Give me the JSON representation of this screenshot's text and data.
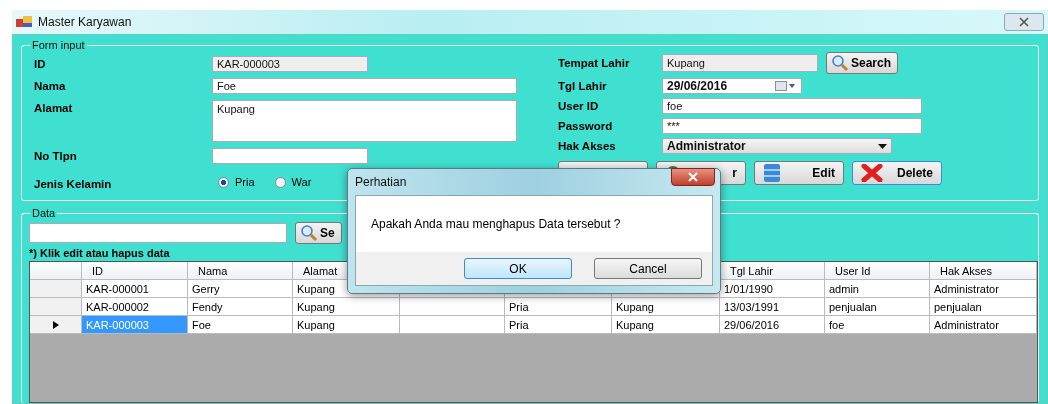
{
  "window": {
    "title": "Master Karyawan"
  },
  "form_input": {
    "title": "Form input",
    "left_fields": [
      {
        "label": "ID",
        "kind": "readonly",
        "value": "KAR-000003"
      },
      {
        "label": "Nama",
        "kind": "text",
        "value": "Foe"
      },
      {
        "label": "Alamat",
        "kind": "textarea",
        "value": "Kupang"
      },
      {
        "label": "No Tlpn",
        "kind": "short"
      },
      {
        "label": "Jenis Kelamin",
        "kind": "radio",
        "options": [
          {
            "label": "Pria",
            "selected": true
          },
          {
            "label": "War",
            "selected": false
          }
        ]
      }
    ],
    "right_fields": [
      {
        "label": "Tempat Lahir",
        "kind": "readonly",
        "value": "Kupang",
        "button": "Search"
      },
      {
        "label": "Tgl Lahir",
        "kind": "date",
        "value": "29/06/2016"
      },
      {
        "label": "User ID",
        "kind": "text",
        "value": "foe"
      },
      {
        "label": "Password",
        "kind": "text",
        "value": "***"
      },
      {
        "label": "Hak Akses",
        "kind": "combo",
        "value": "Administrator"
      }
    ],
    "buttons": [
      {
        "kind": "blank"
      },
      {
        "kind": "clear",
        "label": "r"
      },
      {
        "kind": "edit",
        "label": "Edit"
      },
      {
        "kind": "delete",
        "label": "Delete"
      }
    ]
  },
  "data": {
    "title": "Data",
    "search_button": "Se",
    "note": "*) Klik edit atau hapus data",
    "table": {
      "columns": [
        "ID",
        "Nama",
        "Alamat",
        null,
        null,
        null,
        "Tgl Lahir",
        "User Id",
        "Hak Akses"
      ],
      "rows": [
        {
          "selected": false,
          "cells": [
            "KAR-000001",
            "Gerry",
            "Kupang",
            null,
            null,
            null,
            "1/01/1990",
            "admin",
            "Administrator"
          ]
        },
        {
          "selected": false,
          "cells": [
            "KAR-000002",
            "Fendy",
            "Kupang",
            null,
            "Pria",
            "Kupang",
            "13/03/1991",
            "penjualan",
            "penjualan"
          ]
        },
        {
          "selected": true,
          "cells": [
            "KAR-000003",
            "Foe",
            "Kupang",
            null,
            "Pria",
            "Kupang",
            "29/06/2016",
            "foe",
            "Administrator"
          ]
        }
      ]
    }
  },
  "dialog": {
    "title": "Perhatian",
    "message": "Apakah Anda mau menghapus Data tersebut ?",
    "buttons": [
      {
        "label": "OK",
        "focused": true
      },
      {
        "label": "Cancel",
        "focused": false
      }
    ]
  }
}
